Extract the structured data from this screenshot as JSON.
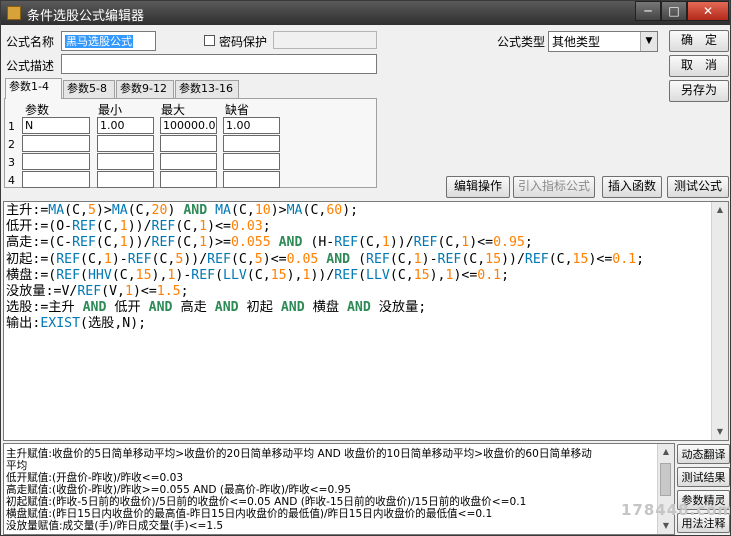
{
  "window": {
    "title": "条件选股公式编辑器",
    "min_label": "─",
    "max_label": "□",
    "close_label": "✕"
  },
  "form": {
    "name_label": "公式名称",
    "name_value": "黑马选股公式",
    "password_label": "密码保护",
    "type_label": "公式类型",
    "type_value": "其他类型",
    "desc_label": "公式描述",
    "desc_value": ""
  },
  "buttons": {
    "ok": "确　定",
    "cancel": "取　消",
    "save_as": "另存为",
    "edit_op": "编辑操作",
    "import_indicator": "引入指标公式",
    "insert_func": "插入函数",
    "test_formula": "测试公式"
  },
  "tabs": [
    "参数1-4",
    "参数5-8",
    "参数9-12",
    "参数13-16"
  ],
  "params": {
    "headers": [
      "参数",
      "最小",
      "最大",
      "缺省"
    ],
    "rows": [
      {
        "num": "1",
        "name": "N",
        "min": "1.00",
        "max": "100000.00",
        "default": "1.00"
      },
      {
        "num": "2",
        "name": "",
        "min": "",
        "max": "",
        "default": ""
      },
      {
        "num": "3",
        "name": "",
        "min": "",
        "max": "",
        "default": ""
      },
      {
        "num": "4",
        "name": "",
        "min": "",
        "max": "",
        "default": ""
      }
    ]
  },
  "code_lines": [
    [
      [
        "v",
        "主升"
      ],
      [
        "c",
        ":="
      ],
      [
        "f",
        "MA"
      ],
      [
        "c",
        "(C,"
      ],
      [
        "n",
        "5"
      ],
      [
        "c",
        ")>"
      ],
      [
        "f",
        "MA"
      ],
      [
        "c",
        "(C,"
      ],
      [
        "n",
        "20"
      ],
      [
        "c",
        ") "
      ],
      [
        "k",
        "AND"
      ],
      [
        "c",
        " "
      ],
      [
        "f",
        "MA"
      ],
      [
        "c",
        "(C,"
      ],
      [
        "n",
        "10"
      ],
      [
        "c",
        ")>"
      ],
      [
        "f",
        "MA"
      ],
      [
        "c",
        "(C,"
      ],
      [
        "n",
        "60"
      ],
      [
        "c",
        ");"
      ]
    ],
    [
      [
        "v",
        "低开"
      ],
      [
        "c",
        ":=(O-"
      ],
      [
        "f",
        "REF"
      ],
      [
        "c",
        "(C,"
      ],
      [
        "n",
        "1"
      ],
      [
        "c",
        "))/"
      ],
      [
        "f",
        "REF"
      ],
      [
        "c",
        "(C,"
      ],
      [
        "n",
        "1"
      ],
      [
        "c",
        ")<="
      ],
      [
        "n",
        "0.03"
      ],
      [
        "c",
        ";"
      ]
    ],
    [
      [
        "v",
        "高走"
      ],
      [
        "c",
        ":=(C-"
      ],
      [
        "f",
        "REF"
      ],
      [
        "c",
        "(C,"
      ],
      [
        "n",
        "1"
      ],
      [
        "c",
        "))/"
      ],
      [
        "f",
        "REF"
      ],
      [
        "c",
        "(C,"
      ],
      [
        "n",
        "1"
      ],
      [
        "c",
        ")>="
      ],
      [
        "n",
        "0.055"
      ],
      [
        "c",
        " "
      ],
      [
        "k",
        "AND"
      ],
      [
        "c",
        " (H-"
      ],
      [
        "f",
        "REF"
      ],
      [
        "c",
        "(C,"
      ],
      [
        "n",
        "1"
      ],
      [
        "c",
        "))/"
      ],
      [
        "f",
        "REF"
      ],
      [
        "c",
        "(C,"
      ],
      [
        "n",
        "1"
      ],
      [
        "c",
        ")<="
      ],
      [
        "n",
        "0.95"
      ],
      [
        "c",
        ";"
      ]
    ],
    [
      [
        "v",
        "初起"
      ],
      [
        "c",
        ":=("
      ],
      [
        "f",
        "REF"
      ],
      [
        "c",
        "(C,"
      ],
      [
        "n",
        "1"
      ],
      [
        "c",
        ")-"
      ],
      [
        "f",
        "REF"
      ],
      [
        "c",
        "(C,"
      ],
      [
        "n",
        "5"
      ],
      [
        "c",
        "))/"
      ],
      [
        "f",
        "REF"
      ],
      [
        "c",
        "(C,"
      ],
      [
        "n",
        "5"
      ],
      [
        "c",
        ")<="
      ],
      [
        "n",
        "0.05"
      ],
      [
        "c",
        " "
      ],
      [
        "k",
        "AND"
      ],
      [
        "c",
        " ("
      ],
      [
        "f",
        "REF"
      ],
      [
        "c",
        "(C,"
      ],
      [
        "n",
        "1"
      ],
      [
        "c",
        ")-"
      ],
      [
        "f",
        "REF"
      ],
      [
        "c",
        "(C,"
      ],
      [
        "n",
        "15"
      ],
      [
        "c",
        "))/"
      ],
      [
        "f",
        "REF"
      ],
      [
        "c",
        "(C,"
      ],
      [
        "n",
        "15"
      ],
      [
        "c",
        ")<="
      ],
      [
        "n",
        "0.1"
      ],
      [
        "c",
        ";"
      ]
    ],
    [
      [
        "v",
        "横盘"
      ],
      [
        "c",
        ":=("
      ],
      [
        "f",
        "REF"
      ],
      [
        "c",
        "("
      ],
      [
        "f",
        "HHV"
      ],
      [
        "c",
        "(C,"
      ],
      [
        "n",
        "15"
      ],
      [
        "c",
        "),"
      ],
      [
        "n",
        "1"
      ],
      [
        "c",
        ")-"
      ],
      [
        "f",
        "REF"
      ],
      [
        "c",
        "("
      ],
      [
        "f",
        "LLV"
      ],
      [
        "c",
        "(C,"
      ],
      [
        "n",
        "15"
      ],
      [
        "c",
        "),"
      ],
      [
        "n",
        "1"
      ],
      [
        "c",
        "))/"
      ],
      [
        "f",
        "REF"
      ],
      [
        "c",
        "("
      ],
      [
        "f",
        "LLV"
      ],
      [
        "c",
        "(C,"
      ],
      [
        "n",
        "15"
      ],
      [
        "c",
        "),"
      ],
      [
        "n",
        "1"
      ],
      [
        "c",
        ")<="
      ],
      [
        "n",
        "0.1"
      ],
      [
        "c",
        ";"
      ]
    ],
    [
      [
        "v",
        "没放量"
      ],
      [
        "c",
        ":=V/"
      ],
      [
        "f",
        "REF"
      ],
      [
        "c",
        "(V,"
      ],
      [
        "n",
        "1"
      ],
      [
        "c",
        ")<="
      ],
      [
        "n",
        "1.5"
      ],
      [
        "c",
        ";"
      ]
    ],
    [
      [
        "v",
        "选股"
      ],
      [
        "c",
        ":=主升 "
      ],
      [
        "k",
        "AND"
      ],
      [
        "c",
        " 低开 "
      ],
      [
        "k",
        "AND"
      ],
      [
        "c",
        " 高走 "
      ],
      [
        "k",
        "AND"
      ],
      [
        "c",
        " 初起 "
      ],
      [
        "k",
        "AND"
      ],
      [
        "c",
        " 横盘 "
      ],
      [
        "k",
        "AND"
      ],
      [
        "c",
        " 没放量;"
      ]
    ],
    [
      [
        "v",
        "输出"
      ],
      [
        "c",
        ":"
      ],
      [
        "f",
        "EXIST"
      ],
      [
        "c",
        "(选股,N);"
      ]
    ]
  ],
  "description_lines": [
    "主升赋值:收盘价的5日简单移动平均>收盘价的20日简单移动平均 AND 收盘价的10日简单移动平均>收盘价的60日简单移动",
    "平均",
    "低开赋值:(开盘价-昨收)/昨收<=0.03",
    "高走赋值:(收盘价-昨收)/昨收>=0.055 AND (最高价-昨收)/昨收<=0.95",
    "初起赋值:(昨收-5日前的收盘价)/5日前的收盘价<=0.05 AND (昨收-15日前的收盘价)/15日前的收盘价<=0.1",
    "横盘赋值:(昨日15日内收盘价的最高值-昨日15日内收盘价的最低值)/昨日15日内收盘价的最低值<=0.1",
    "没放量赋值:成交量(手)/昨日成交量(手)<=1.5"
  ],
  "side_buttons": [
    "动态翻译",
    "测试结果",
    "参数精灵",
    "用法注释"
  ],
  "watermark": "178448.com"
}
